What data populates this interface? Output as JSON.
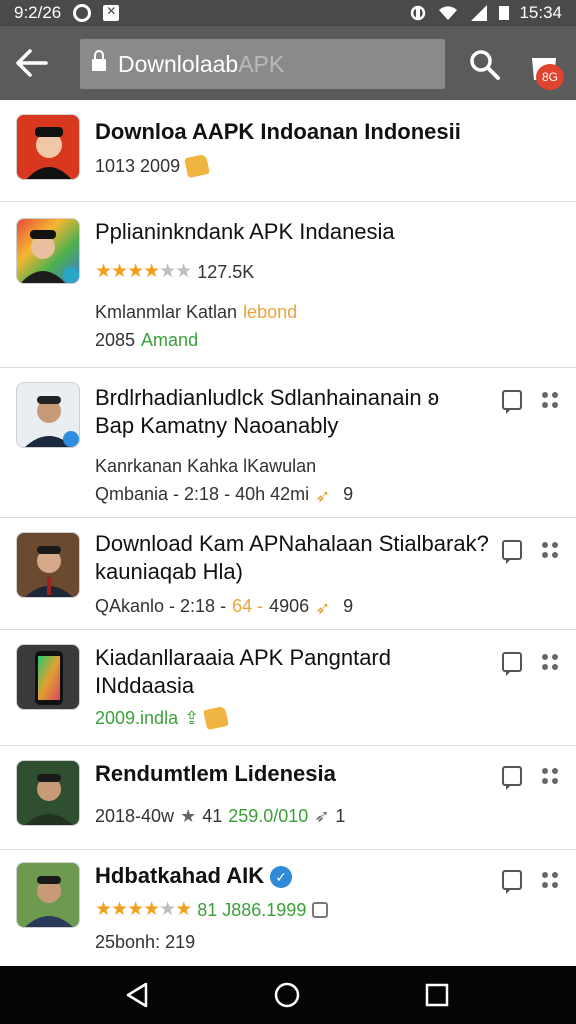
{
  "status": {
    "left_text": "9:2/26",
    "time": "15:34"
  },
  "search": {
    "text": "Downlolaab",
    "ghost": "APK"
  },
  "cart": {
    "badge": "8G"
  },
  "items": [
    {
      "title": "Downloa AAPK Indoanan Indonesii",
      "meta": "1013 2009"
    },
    {
      "title": "Pplianinkndank APK Indanesia",
      "rating_text": "127.5K",
      "desc": "Kmlanmlar Katlan",
      "desc_accent": "lebond",
      "line3a": "2085",
      "line3b": "Amand"
    },
    {
      "title": "Brdlrhadianludlck Sdlanhainanain",
      "title_tail": "ʚ",
      "title2": "Bap Kamatny Naoanably",
      "desc": "Kanrkanan Kahka lKawulan",
      "meta": "Qmbania - 2:18 - 40h 42mi",
      "meta_icon_text": "9"
    },
    {
      "title": "Download Kam APNahalaan Stialbarak?",
      "title2": "kauniaqab Hla)",
      "meta": "QAkanlo - 2:18 -",
      "meta_accent": "64 -",
      "meta_tail": "4906",
      "meta_icon_text": "9"
    },
    {
      "title": "Kiadanllaraaia APK Pangntard",
      "title2": "INddaasia",
      "meta": "2009.indla"
    },
    {
      "title": "Rendumtlem Lidenesia",
      "meta": "2018-40w",
      "meta_num": "41",
      "meta_accent": "259.0/010",
      "meta_icon_text": "1"
    },
    {
      "title": "Hdbatkahad AIK",
      "meta_accent": "81 J886.1999",
      "desc": "25bonh: 219"
    }
  ],
  "colors": {
    "appbar": "#5b5b5b",
    "statusbar": "#4a4a4a",
    "star": "#f0a020",
    "green": "#3aa03a",
    "accent_orange": "#f0a23a",
    "verified": "#2f8ad8",
    "badge": "#e0442e"
  }
}
